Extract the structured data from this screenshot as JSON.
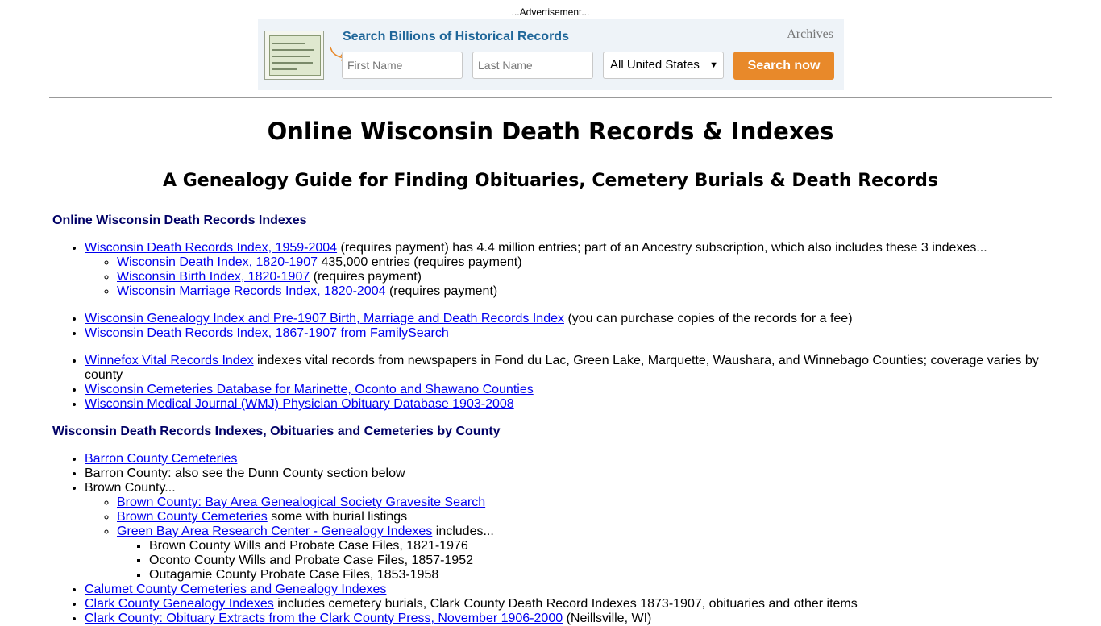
{
  "ad": {
    "label": "...Advertisement...",
    "headline": "Search Billions of Historical Records",
    "brand": "Archives",
    "first_name_placeholder": "First Name",
    "last_name_placeholder": "Last Name",
    "location_selected": "All United States",
    "search_label": "Search now",
    "button_color": "#e8892a",
    "headline_color": "#1f6699"
  },
  "page": {
    "title": "Online Wisconsin Death Records & Indexes",
    "subtitle": "A Genealogy Guide for Finding Obituaries, Cemetery Burials & Death Records"
  },
  "sections": {
    "statewide": {
      "heading": "Online Wisconsin Death Records Indexes",
      "items": [
        {
          "link": "Wisconsin Death Records Index, 1959-2004",
          "text": " (requires payment) has 4.4 million entries; part of an Ancestry subscription, which also includes these 3 indexes..."
        },
        {
          "link": "Wisconsin Death Index, 1820-1907",
          "text": " 435,000 entries (requires payment)"
        },
        {
          "link": "Wisconsin Birth Index, 1820-1907",
          "text": " (requires payment)"
        },
        {
          "link": "Wisconsin Marriage Records Index, 1820-2004",
          "text": " (requires payment)"
        },
        {
          "link": "Wisconsin Genealogy Index and Pre-1907 Birth, Marriage and Death Records Index",
          "text": " (you can purchase copies of the records for a fee)"
        },
        {
          "link": "Wisconsin Death Records Index, 1867-1907 from FamilySearch",
          "text": ""
        },
        {
          "link": "Winnefox Vital Records Index",
          "text": " indexes vital records from newspapers in Fond du Lac, Green Lake, Marquette, Waushara, and Winnebago Counties; coverage varies by county"
        },
        {
          "link": "Wisconsin Cemeteries Database for Marinette, Oconto and Shawano Counties",
          "text": ""
        },
        {
          "link": "Wisconsin Medical Journal (WMJ) Physician Obituary Database 1903-2008",
          "text": ""
        }
      ]
    },
    "county": {
      "heading": "Wisconsin Death Records Indexes, Obituaries and Cemeteries by County",
      "items": [
        {
          "link": "Barron County Cemeteries",
          "text": ""
        },
        {
          "link": "",
          "text": "Barron County: also see the Dunn County section below"
        },
        {
          "link": "",
          "text": "Brown County..."
        },
        {
          "link": "Brown County: Bay Area Genealogical Society Gravesite Search",
          "text": ""
        },
        {
          "link": "Brown County Cemeteries",
          "text": " some with burial listings"
        },
        {
          "link": "Green Bay Area Research Center - Genealogy Indexes",
          "text": " includes..."
        },
        {
          "link": "",
          "text": "Brown County Wills and Probate Case Files, 1821-1976"
        },
        {
          "link": "",
          "text": "Oconto County Wills and Probate Case Files, 1857-1952"
        },
        {
          "link": "",
          "text": "Outagamie County Probate Case Files, 1853-1958"
        },
        {
          "link": "Calumet County Cemeteries and Genealogy Indexes",
          "text": ""
        },
        {
          "link": "Clark County Genealogy Indexes",
          "text": " includes cemetery burials, Clark County Death Record Indexes 1873-1907, obituaries and other items"
        },
        {
          "link": "Clark County: Obituary Extracts from the Clark County Press, November 1906-2000",
          "text": " (Neillsville, WI)"
        }
      ]
    }
  }
}
